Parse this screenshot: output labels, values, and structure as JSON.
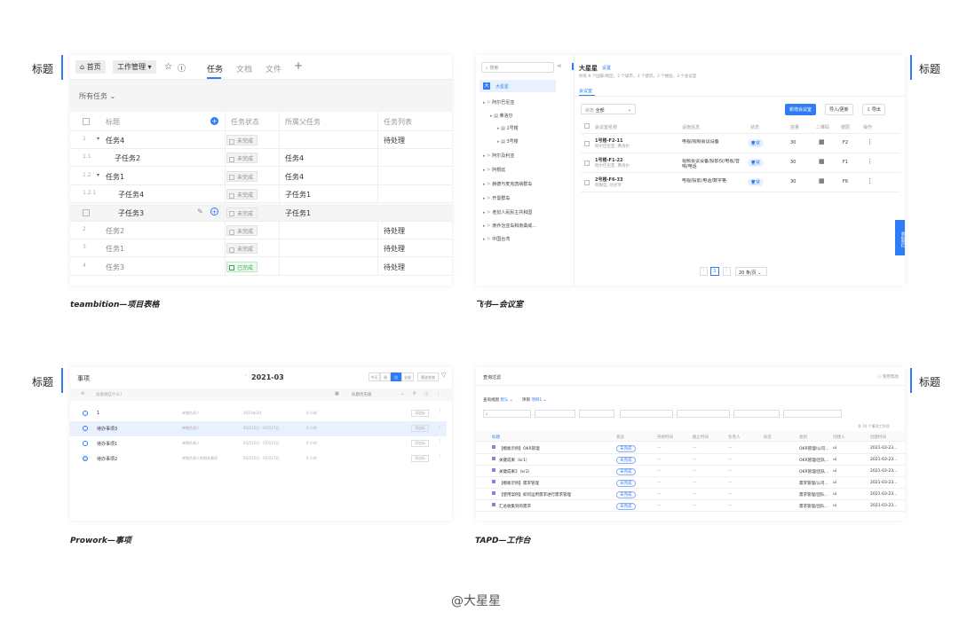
{
  "annotation": "标题",
  "watermark": "@大星星",
  "captions": {
    "tb": "teambition—项目表格",
    "fs": "飞书—会议室",
    "pw": "Prowork—事项",
    "td": "TAPD—工作台"
  },
  "tb": {
    "home": "首页",
    "work": "工作管理",
    "tabs": [
      "任务",
      "文档",
      "文件"
    ],
    "filter": "所有任务",
    "headers": [
      "标题",
      "任务状态",
      "所属父任务",
      "任务列表"
    ],
    "rows": [
      {
        "num": "1",
        "title": "任务4",
        "status": "未完成",
        "parent": "",
        "list": "待处理"
      },
      {
        "num": "1.1",
        "title": "子任务2",
        "status": "未完成",
        "parent": "任务4",
        "list": ""
      },
      {
        "num": "1.2",
        "title": "任务1",
        "status": "未完成",
        "parent": "任务4",
        "list": ""
      },
      {
        "num": "1.2.1",
        "title": "子任务4",
        "status": "未完成",
        "parent": "子任务1",
        "list": ""
      },
      {
        "num": "",
        "title": "子任务3",
        "status": "未完成",
        "parent": "子任务1",
        "list": ""
      },
      {
        "num": "2",
        "title": "任务2",
        "status": "未完成",
        "parent": "",
        "list": "待处理"
      },
      {
        "num": "3",
        "title": "任务1",
        "status": "未完成",
        "parent": "",
        "list": "待处理"
      },
      {
        "num": "4",
        "title": "任务3",
        "status": "已完成",
        "parent": "",
        "list": "待处理"
      }
    ]
  },
  "fs": {
    "search": "搜索",
    "root": "大星星",
    "title": "大星星",
    "settings": "设置",
    "subtitle": "你有 8 个国家/地区，2 个城市，3 个建筑，3 个楼层，3 个会议室",
    "tab": "会议室",
    "tree": [
      "阿尔巴尼亚",
      "弗洛尔",
      "1号楼",
      "3号楼",
      "阿尔及利亚",
      "阿根廷",
      "赫德与麦克唐纳群岛",
      "开曼群岛",
      "老挝人民民主共和国",
      "南乔治亚岛和南桑威...",
      "中国台湾"
    ],
    "filterLabel": "状态",
    "filterVal": "全部",
    "btnNew": "新增会议室",
    "btnImport": "导入/更新",
    "btnExport": "导出",
    "headers": [
      "会议室名称",
      "设施信息",
      "状态",
      "容量",
      "二维码",
      "楼层",
      "操作"
    ],
    "rows": [
      {
        "name": "1号楼-F2-11",
        "sub": "阿尔巴尼亚, 弗洛尔",
        "fac": "电视/视频会议设备",
        "st": "正常",
        "cap": "30",
        "fl": "F2"
      },
      {
        "name": "1号楼-F1-22",
        "sub": "阿尔巴尼亚, 弗洛尔",
        "fac": "视频会议设备/投影仪/电视/音响/电话",
        "st": "正常",
        "cap": "30",
        "fl": "F1"
      },
      {
        "name": "2号楼-F6-33",
        "sub": "阿根廷, 达达罗",
        "fac": "电视/投影/电话/数字格",
        "st": "正常",
        "cap": "30",
        "fl": "F6"
      }
    ],
    "page": "1",
    "pageSize": "20 条/页",
    "side": "收起侧栏"
  },
  "pw": {
    "title": "事项",
    "month": "2021-03",
    "views": [
      "今天",
      "周",
      "月",
      "全部",
      "筛选状态"
    ],
    "placeholder": "准备做些什么?",
    "sort": "标题优先级",
    "rows": [
      {
        "t": "1",
        "a": "单独负责人",
        "d": "2021年3月",
        "h": "0 小时",
        "btn": "添加标"
      },
      {
        "t": "待办事项3",
        "a": "单独负责人",
        "d": "03月15日 - 03月17日",
        "h": "0 小时",
        "btn": "添加标"
      },
      {
        "t": "待办事项1",
        "a": "单独负责人",
        "d": "03月15日 - 03月15日",
        "h": "0 小时",
        "btn": "添加标"
      },
      {
        "t": "待办事项2",
        "a": "单独负责人的相关事项",
        "d": "03月15日 - 03月17日",
        "h": "0 小时",
        "btn": "添加标"
      }
    ]
  },
  "td": {
    "title": "查询过滤",
    "help": "使用帮助",
    "view": "查询视图",
    "viewVal": "默认",
    "proj": "项目",
    "projVal": "项目1",
    "count": "共 16 个事项工作项",
    "headers": [
      "标题",
      "状态",
      "开始时间",
      "截止时间",
      "负责人",
      "标签",
      "类别",
      "创建人",
      "创建时间"
    ],
    "rows": [
      {
        "t": "【模板示例】OKR管理",
        "st": "未完成",
        "c": "OKR管理/公司...",
        "u": "ui",
        "dt": "2021-03-23..."
      },
      {
        "t": "关键成果（kr1）",
        "st": "未完成",
        "c": "OKR管理/团队...",
        "u": "ui",
        "dt": "2021-03-23..."
      },
      {
        "t": "关键成果2（kr2）",
        "st": "未完成",
        "c": "OKR管理/团队...",
        "u": "ui",
        "dt": "2021-03-23..."
      },
      {
        "t": "【模板示例】需求管理",
        "st": "未完成",
        "c": "需求管理/公司...",
        "u": "ui",
        "dt": "2021-03-23..."
      },
      {
        "t": "【使用案例】如何运用需求进行需求管理",
        "st": "未完成",
        "c": "需求管理/团队...",
        "u": "ui",
        "dt": "2021-03-23..."
      },
      {
        "t": "汇总收集到的需求",
        "st": "未完成",
        "c": "需求管理/团队...",
        "u": "ui",
        "dt": "2021-03-23..."
      }
    ]
  }
}
